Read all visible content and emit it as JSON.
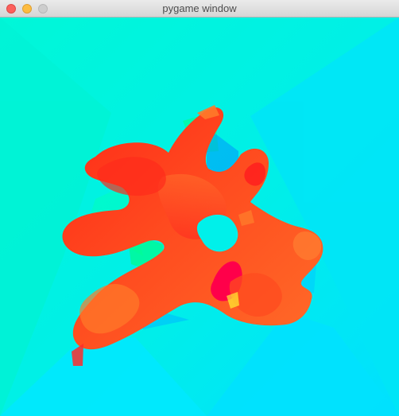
{
  "window": {
    "title": "pygame window",
    "controls": [
      "close",
      "minimize",
      "zoom"
    ]
  },
  "colors": {
    "background": "#00f0e6",
    "shape_primary": "#ff3d1a",
    "shape_secondary": "#ff6a24",
    "shape_accent": "#ff0045",
    "highlight": "#00ff7a"
  }
}
